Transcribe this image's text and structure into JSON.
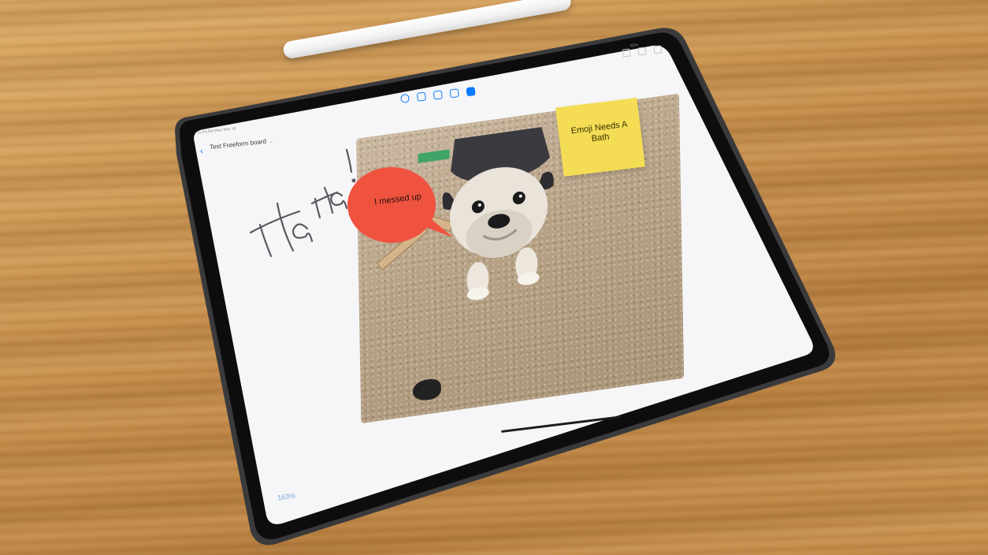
{
  "status_bar": {
    "time": "11:54 AM Wed Nov 16",
    "right": "82%"
  },
  "header": {
    "back_icon": "chevron-left-icon",
    "title": "Test Freeform board",
    "chevron": "⌄"
  },
  "toolbar": {
    "icons": [
      "pen-icon",
      "shapes-icon",
      "text-box-icon",
      "sticky-note-icon",
      "media-icon"
    ]
  },
  "canvas": {
    "handwriting": "Ha Ha!",
    "speech_bubble": {
      "text": "I messed up",
      "color": "#ef5340"
    },
    "sticky_note": {
      "text": "Emoji Needs A Bath",
      "color": "#f4dd55"
    },
    "photo": {
      "subject": "bulldog-photo"
    }
  },
  "footer": {
    "zoom": "163%"
  },
  "colors": {
    "accent": "#0a7aff",
    "bubble": "#ef5340",
    "sticky": "#f4dd55"
  }
}
